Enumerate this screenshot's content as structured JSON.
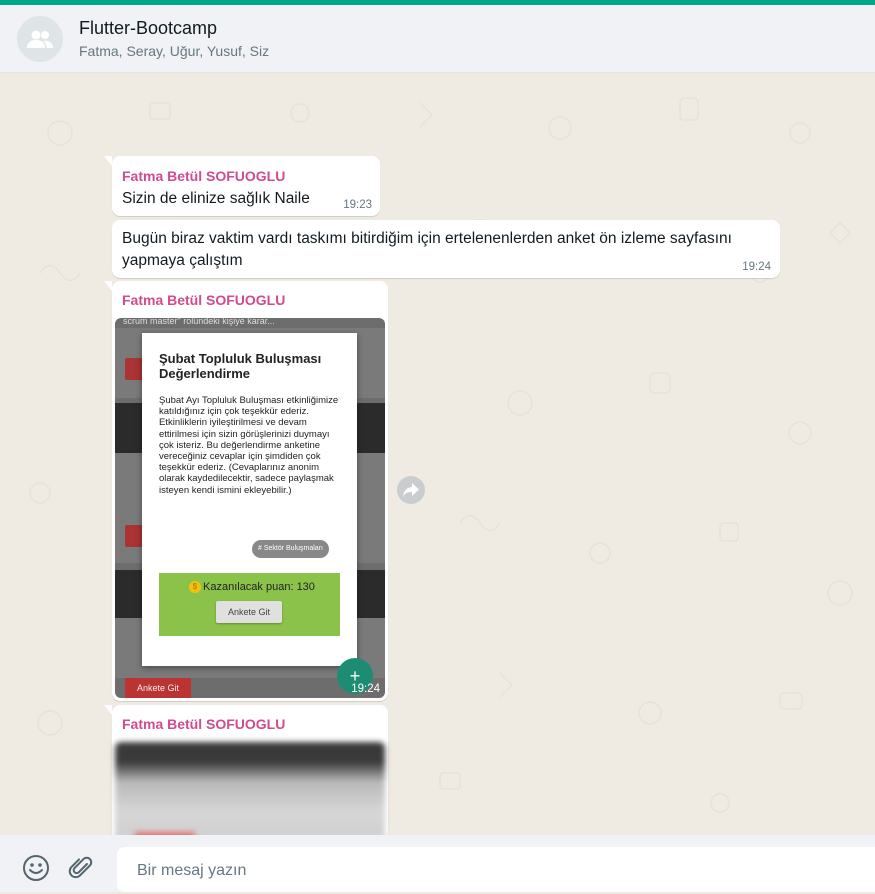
{
  "header": {
    "title": "Flutter-Bootcamp",
    "members": "Fatma, Seray, Uğur, Yusuf, Siz",
    "avatar_icon": "group-icon"
  },
  "colors": {
    "accent": "#00a884",
    "sender_name": "#d14b8f",
    "chat_bg": "#efeae2"
  },
  "messages": [
    {
      "sender": "Fatma Betül SOFUOGLU",
      "text": "Sizin de elinize sağlık Naile",
      "time": "19:23"
    },
    {
      "text": "Bugün biraz vaktim vardı taskımı bitirdiğim için ertelenenlerden anket ön izleme sayfasını yapmaya çalıştım",
      "time": "19:24"
    },
    {
      "sender": "Fatma Betül SOFUOGLU",
      "time": "19:24",
      "image": {
        "bg_text_1": "scrum master\" rolündeki kişiye karar...",
        "dialog_title": "Şubat Topluluk Buluşması Değerlendirme",
        "dialog_body": "Şubat Ayı Topluluk Buluşması etkinliğimize katıldığınız için çok teşekkür ederiz. Etkinliklerin iyileştirilmesi ve devam ettirilmesi için sizin görüşlerinizi duymayı çok isteriz. Bu değerlendirme anketine vereceğiniz cevaplar için şimdiden çok teşekkür ederiz.  (Cevaplarınız anonim olarak kaydedilecektir, sadece paylaşmak isteyen kendi ismini ekleyebilir.)",
        "tag": "# Sektör Buluşmaları",
        "points_label": "Kazanılacak puan: 130",
        "button_label": "Ankete Git",
        "bottom_button": "Ankete Git"
      }
    },
    {
      "sender": "Fatma Betül SOFUOGLU"
    }
  ],
  "composer": {
    "placeholder": "Bir mesaj yazın",
    "emoji_icon": "emoji-icon",
    "attach_icon": "paperclip-icon"
  }
}
